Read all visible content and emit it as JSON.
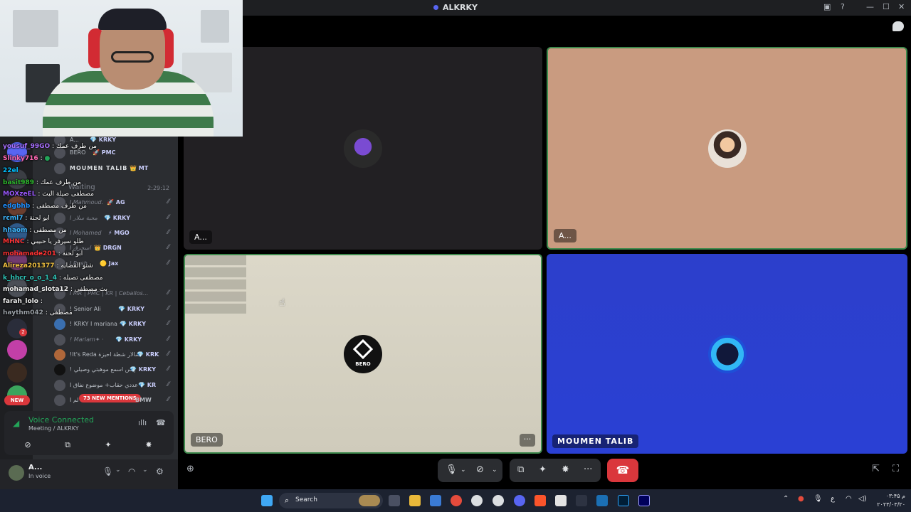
{
  "window": {
    "title": "ALKRKY"
  },
  "tiles": [
    {
      "name": "A...",
      "more": ""
    },
    {
      "name": "A...",
      "more": ""
    },
    {
      "name": "BERO",
      "more": "···",
      "avatar_text": "BERO"
    },
    {
      "name": "MOUMEN TALIB",
      "more": ""
    }
  ],
  "users": [
    {
      "name": "A...",
      "role": "💎 KRKY",
      "time": ""
    },
    {
      "name": "BERO",
      "role": "🚀 PMC",
      "time": ""
    },
    {
      "name": "MOUMEN TALIB",
      "role": "👑 MT",
      "time": ""
    },
    {
      "name": "Waiting",
      "role": "",
      "time": "2:29:12"
    },
    {
      "name": "I Mahmoud.",
      "role": "🚀 AG",
      "time": ""
    },
    {
      "name": "I محبة سلار",
      "role": "💎 KRKY",
      "time": ""
    },
    {
      "name": "I Mohamed",
      "role": "⚡ MGO",
      "time": ""
    },
    {
      "name": "I اسحرق",
      "role": "👑 DRGN",
      "time": ""
    },
    {
      "name": "I Rush",
      "role": "🟡 Jax",
      "time": ""
    },
    {
      "name": "I MR | PMC | KR | Ceballos...",
      "role": "",
      "time": ""
    },
    {
      "name": "! Senior Ali",
      "role": "💎 KRKY",
      "time": ""
    },
    {
      "name": "! KRKY I mariana ·",
      "role": "💎 KRKY",
      "time": ""
    },
    {
      "name": "! Mariam✦ ·",
      "role": "💎 KRKY",
      "time": ""
    },
    {
      "name": "!It's Reda سالار شطة احيزة",
      "role": "💎 KRK",
      "time": ""
    },
    {
      "name": "! إبس اسمع موهبتي وصيلي",
      "role": "💎 KRKY",
      "time": ""
    },
    {
      "name": "I عددي حقاب+ موضوع نفاق",
      "role": "💎 KR",
      "time": ""
    },
    {
      "name": "I لم",
      "role": "BMW",
      "time": ""
    }
  ],
  "chat": [
    {
      "user": "yousuf_99GO",
      "text": ": من طرف عمك",
      "color": "#a970ff"
    },
    {
      "user": "Slinky716",
      "text": ":",
      "color": "#ff69b4"
    },
    {
      "user": "22el",
      "text": "",
      "color": "#00bfff"
    },
    {
      "user": "basit989",
      "text": ": من طرف عمك",
      "color": "#2eb82e"
    },
    {
      "user": "MOXzeEL",
      "text": ": مصطفى صيلة البث",
      "color": "#9b59ff"
    },
    {
      "user": "edgbhb",
      "text": ": من طرف مصطفى",
      "color": "#1e90ff"
    },
    {
      "user": "rcml7",
      "text": ": ابو لحنة",
      "color": "#3fb8ff"
    },
    {
      "user": "hhaom",
      "text": ": من مصطفى",
      "color": "#3fb8ff"
    },
    {
      "user": "MHNC",
      "text": ": طلو سيرفر يا حبيبي",
      "color": "#ff3333"
    },
    {
      "user": "mohamade201",
      "text": ": ابو لحنة",
      "color": "#ff3333"
    },
    {
      "user": "Alireza201377",
      "text": ": شتو القضايه",
      "color": "#f0c040"
    },
    {
      "user": "k_hhcr_o_o_1_4",
      "text": ": مصطفى تصبله",
      "color": "#2ec4b6"
    },
    {
      "user": "mohamad_slota12",
      "text": ": بث مصطفى",
      "color": "#f0f0f0"
    },
    {
      "user": "farah_lolo",
      "text": ":",
      "color": "#f0f0f0"
    },
    {
      "user": "haythm042",
      "text": ": مصطفى",
      "color": "#9aa0a6"
    }
  ],
  "servers": {
    "new_label": "NEW",
    "badge": "2",
    "mentions": "73 NEW MENTIONS"
  },
  "voice": {
    "state": "Voice Connected",
    "location": "Meeting / ALKRKY"
  },
  "user": {
    "name": "A...",
    "status": "In voice"
  },
  "taskbar": {
    "search_placeholder": "Search",
    "clock_time": "۰۳:۴۵ م",
    "clock_date": "۲۰۲۳/۰۳/۲۰",
    "lang": "ع"
  },
  "colors": {
    "accent": "#5865f2",
    "danger": "#da373c",
    "online": "#23a559",
    "speaking": "#3e8a4d"
  }
}
